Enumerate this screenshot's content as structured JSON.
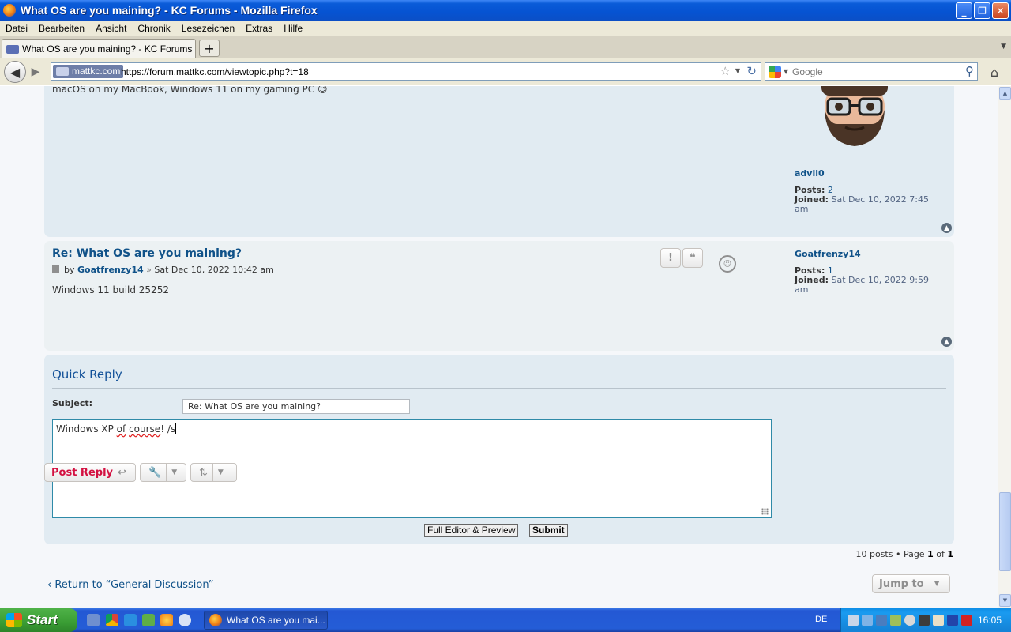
{
  "window": {
    "title": "What OS are you maining? - KC Forums - Mozilla Firefox",
    "minimize": "_",
    "maximize": "❐",
    "close": "✕"
  },
  "menu": [
    "Datei",
    "Bearbeiten",
    "Ansicht",
    "Chronik",
    "Lesezeichen",
    "Extras",
    "Hilfe"
  ],
  "tab": {
    "label": "What OS are you maining? - KC Forums",
    "new_tab": "+"
  },
  "nav": {
    "site_identity": "mattkc.com",
    "url": "https://forum.mattkc.com/viewtopic.php?t=18",
    "search_placeholder": "Google"
  },
  "post1": {
    "body": "macOS on my MacBook, Windows 11 on my gaming PC",
    "emoji": "😉",
    "author": "advil0",
    "posts_label": "Posts:",
    "posts": "2",
    "joined_label": "Joined:",
    "joined": "Sat Dec 10, 2022 7:45 am"
  },
  "post2": {
    "title": "Re: What OS are you maining?",
    "by": "by",
    "author": "Goatfrenzy14",
    "sep": "»",
    "date": "Sat Dec 10, 2022 10:42 am",
    "body": "Windows 11 build 25252",
    "report": "!",
    "quote": "❝",
    "posts_label": "Posts:",
    "posts": "1",
    "joined_label": "Joined:",
    "joined": "Sat Dec 10, 2022 9:59 am"
  },
  "quick_reply": {
    "title": "Quick Reply",
    "subject_label": "Subject:",
    "subject_value": "Re: What OS are you maining?",
    "text_part1": "Windows XP ",
    "text_misspelled1": "of",
    "text_space": " ",
    "text_misspelled2": "course",
    "text_part2": "! /s",
    "full_editor": "Full Editor & Preview",
    "submit": "Submit"
  },
  "actions": {
    "post_reply": "Post Reply",
    "pagination_posts": "10 posts • Page",
    "page_current": "1",
    "page_of": "of",
    "page_total": "1",
    "return": "Return to “General Discussion”",
    "return_arrow": "‹",
    "jump_to": "Jump to"
  },
  "taskbar": {
    "start": "Start",
    "task_label": "What OS are you mai...",
    "language": "DE",
    "clock": "16:05"
  },
  "colors": {
    "forum_link": "#105289",
    "post_reply": "#d31141",
    "post_bg_1": "#e1ebf2",
    "post_bg_2": "#ecf1f3"
  }
}
